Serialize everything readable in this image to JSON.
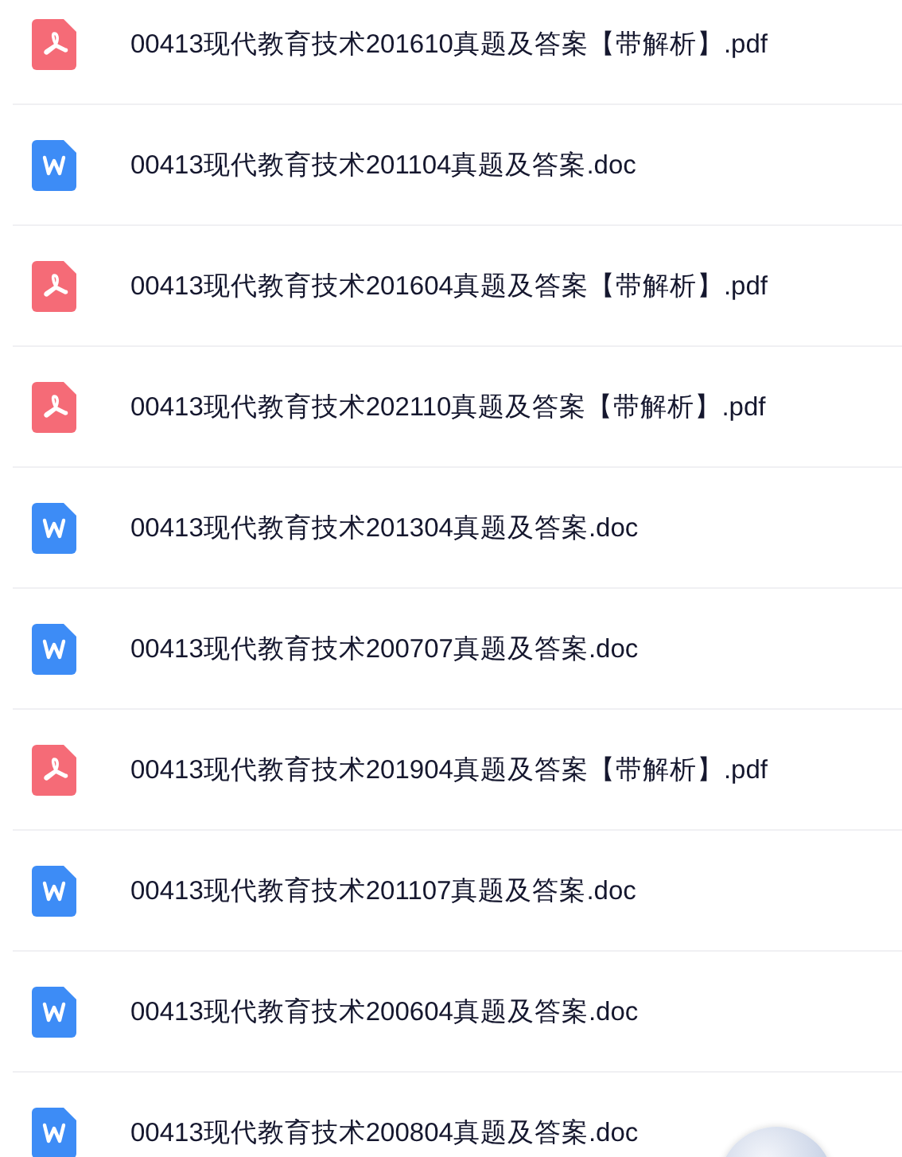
{
  "files": [
    {
      "kind": "pdf",
      "name": "00413现代教育技术201610真题及答案【带解析】.pdf"
    },
    {
      "kind": "doc",
      "name": "00413现代教育技术201104真题及答案.doc"
    },
    {
      "kind": "pdf",
      "name": "00413现代教育技术201604真题及答案【带解析】.pdf"
    },
    {
      "kind": "pdf",
      "name": "00413现代教育技术202110真题及答案【带解析】.pdf"
    },
    {
      "kind": "doc",
      "name": "00413现代教育技术201304真题及答案.doc"
    },
    {
      "kind": "doc",
      "name": "00413现代教育技术200707真题及答案.doc"
    },
    {
      "kind": "pdf",
      "name": "00413现代教育技术201904真题及答案【带解析】.pdf"
    },
    {
      "kind": "doc",
      "name": "00413现代教育技术201107真题及答案.doc"
    },
    {
      "kind": "doc",
      "name": "00413现代教育技术200604真题及答案.doc"
    },
    {
      "kind": "doc",
      "name": "00413现代教育技术200804真题及答案.doc"
    }
  ]
}
